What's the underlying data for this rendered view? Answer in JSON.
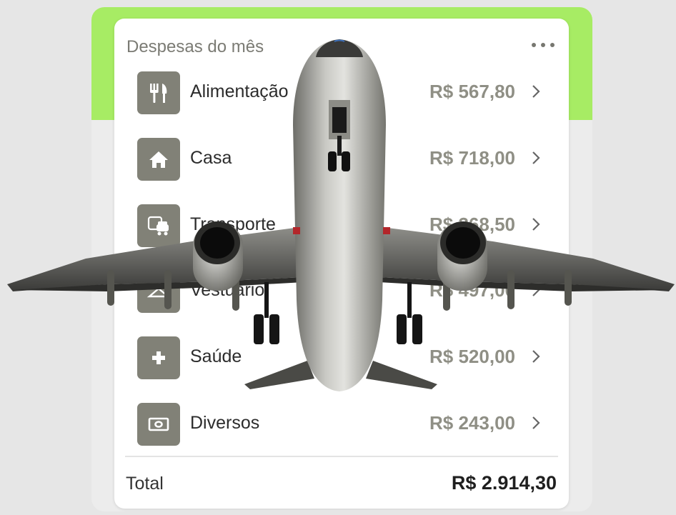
{
  "card": {
    "title": "Despesas do mês",
    "more_icon": "ellipsis-icon",
    "items": [
      {
        "label": "Alimentação",
        "amount": "R$ 567,80",
        "icon": "utensils-icon"
      },
      {
        "label": "Casa",
        "amount": "R$ 718,00",
        "icon": "home-icon"
      },
      {
        "label": "Transporte",
        "amount": "R$ 368,50",
        "icon": "car-icon"
      },
      {
        "label": "Vestuário",
        "amount": "R$ 497,00",
        "icon": "hanger-icon"
      },
      {
        "label": "Saúde",
        "amount": "R$ 520,00",
        "icon": "medical-cross-icon"
      },
      {
        "label": "Diversos",
        "amount": "R$ 243,00",
        "icon": "banknote-icon"
      }
    ],
    "total_label": "Total",
    "total_value": "R$ 2.914,30"
  },
  "colors": {
    "accent_green": "#a7ec64",
    "icon_tile": "#818177",
    "amount_text": "#8f8f85"
  },
  "overlay": {
    "icon": "airplane-icon"
  }
}
